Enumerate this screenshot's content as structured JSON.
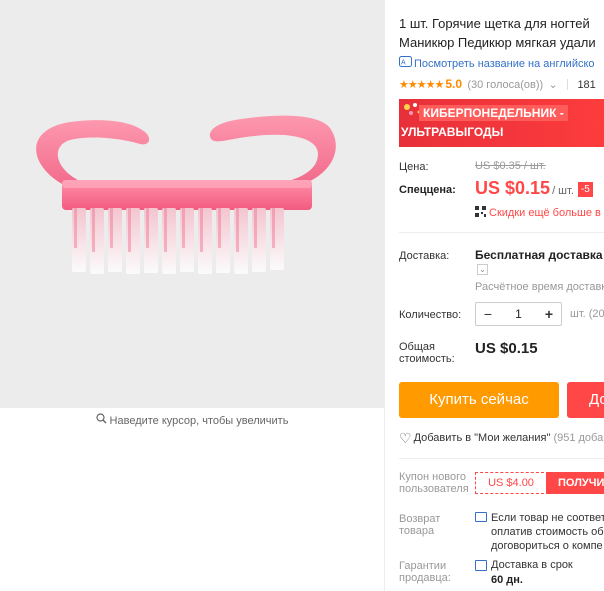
{
  "image_area": {
    "zoom_hint": "Наведите курсор, чтобы увеличить"
  },
  "product": {
    "title_line1": "1 шт. Горячие щетка для ногтей",
    "title_line2": "Маникюр Педикюр мягкая удали",
    "translate_link": "Посмотреть название на английско",
    "rating_score": "5.0",
    "rating_votes": "(30 голоса(ов))",
    "orders": "181"
  },
  "promo": {
    "line1": "КИБЕРПОНЕДЕЛЬНИК -",
    "line2": "УЛЬТРАВЫГОДЫ"
  },
  "price": {
    "label": "Цена:",
    "old": "US $0.35 / шт.",
    "special_label": "Спеццена:",
    "new": "US $0.15",
    "unit": "/ шт.",
    "discount_badge": "-5",
    "discount_text": "Скидки ещё больше в"
  },
  "shipping": {
    "label": "Доставка:",
    "value": "Бесплатная доставка в Р",
    "time": "Расчётное время доставк"
  },
  "quantity": {
    "label": "Количество:",
    "value": "1",
    "minus": "−",
    "plus": "+",
    "note": "шт. (20"
  },
  "total": {
    "label_line1": "Общая",
    "label_line2": "стоимость:",
    "value": "US $0.15"
  },
  "actions": {
    "buy_now": "Купить сейчас",
    "add_to_cart": "До",
    "wishlist": "Добавить в \"Мои желания\"",
    "wishlist_count": "(951 доба"
  },
  "coupon": {
    "label_line1": "Купон нового",
    "label_line2": "пользователя",
    "amount": "US $4.00",
    "get": "ПОЛУЧИ"
  },
  "returns": {
    "label_line1": "Возврат",
    "label_line2": "товара",
    "line1": "Если товар не соответ",
    "line2": "оплатив стоимость об",
    "line3": "договориться о компе"
  },
  "guarantee": {
    "label_line1": "Гарантии",
    "label_line2": "продавца:",
    "text": "Доставка в срок",
    "days": "60 дн."
  },
  "colors": {
    "accent_orange": "#ff9a00",
    "accent_red": "#ff4747",
    "link_blue": "#3471c7"
  }
}
